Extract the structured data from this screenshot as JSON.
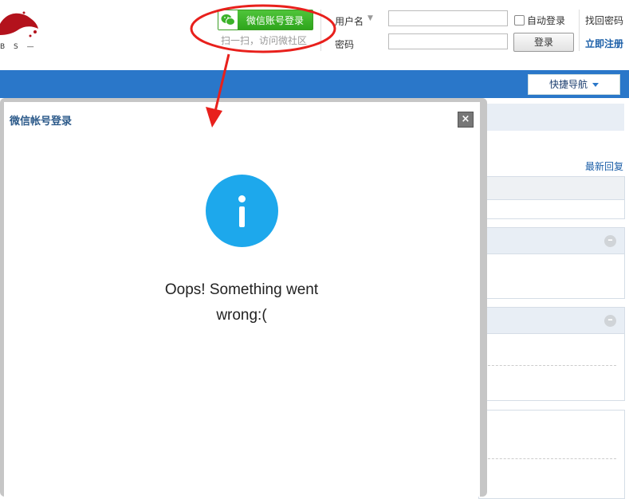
{
  "logo": {
    "text": "B S —"
  },
  "wechat": {
    "button_label": "微信账号登录",
    "hint": "扫一扫，访问微社区",
    "icon": "wechat-icon"
  },
  "login": {
    "username_label": "用户名",
    "password_label": "密码",
    "username_value": "",
    "password_value": "",
    "auto_login_label": "自动登录",
    "auto_login_checked": false,
    "login_button": "登录",
    "forgot_password": "找回密码",
    "register": "立即注册"
  },
  "nav": {
    "quick_nav_label": "快捷导航",
    "bar_color": "#2a77c9"
  },
  "page": {
    "latest_reply": "最新回复"
  },
  "modal": {
    "title": "微信帐号登录",
    "close_icon": "close-icon",
    "info_icon": "info-icon",
    "message_line1": "Oops! Something went",
    "message_line2": "wrong:("
  },
  "colors": {
    "info_blue": "#1da8ec",
    "wechat_green": "#3bb22a",
    "annotation_red": "#e8201c",
    "link_blue": "#1c5fa8"
  }
}
